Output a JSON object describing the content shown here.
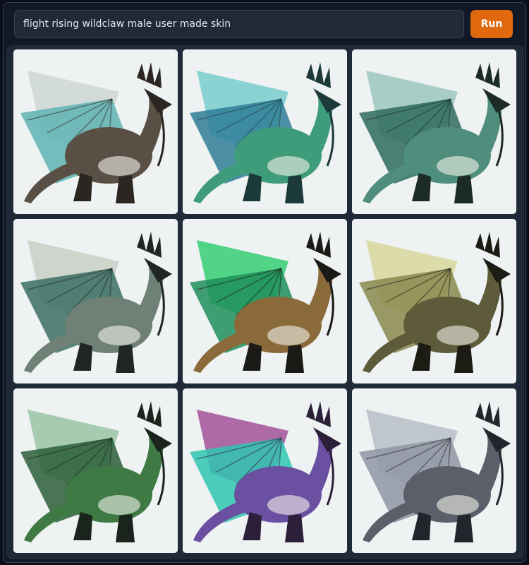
{
  "prompt": {
    "value": "flight rising wildclaw male user made skin"
  },
  "run_button": {
    "label": "Run",
    "color": "#e0690e"
  },
  "gallery": {
    "images": [
      {
        "name": "generated-image-1",
        "palette": {
          "wing": "#cfd8d6",
          "body": "#5a4f45",
          "accent": "#5fb3b3",
          "dark": "#2b2622"
        }
      },
      {
        "name": "generated-image-2",
        "palette": {
          "wing": "#7fcfcf",
          "body": "#3f9c7a",
          "accent": "#2f7e96",
          "dark": "#1d3a3a"
        }
      },
      {
        "name": "generated-image-3",
        "palette": {
          "wing": "#9fc9bf",
          "body": "#4f8e7c",
          "accent": "#2e6b5b",
          "dark": "#1d2b27"
        }
      },
      {
        "name": "generated-image-4",
        "palette": {
          "wing": "#c9d2c9",
          "body": "#6f8076",
          "accent": "#3b6f63",
          "dark": "#202624"
        }
      },
      {
        "name": "generated-image-5",
        "palette": {
          "wing": "#3fd07a",
          "body": "#8a6a3a",
          "accent": "#1e8f5a",
          "dark": "#1b1a16"
        }
      },
      {
        "name": "generated-image-6",
        "palette": {
          "wing": "#d9d8a2",
          "body": "#5e5b3a",
          "accent": "#8a8a4f",
          "dark": "#1c1b14"
        }
      },
      {
        "name": "generated-image-7",
        "palette": {
          "wing": "#9fc7a9",
          "body": "#3f7a45",
          "accent": "#2b5f3a",
          "dark": "#1b241c"
        }
      },
      {
        "name": "generated-image-8",
        "palette": {
          "wing": "#a65a9e",
          "body": "#6b4fa0",
          "accent": "#2fc7b3",
          "dark": "#2b1f3a"
        }
      },
      {
        "name": "generated-image-9",
        "palette": {
          "wing": "#b9c1c9",
          "body": "#5a5f6a",
          "accent": "#8f97a3",
          "dark": "#22252b"
        }
      }
    ]
  }
}
